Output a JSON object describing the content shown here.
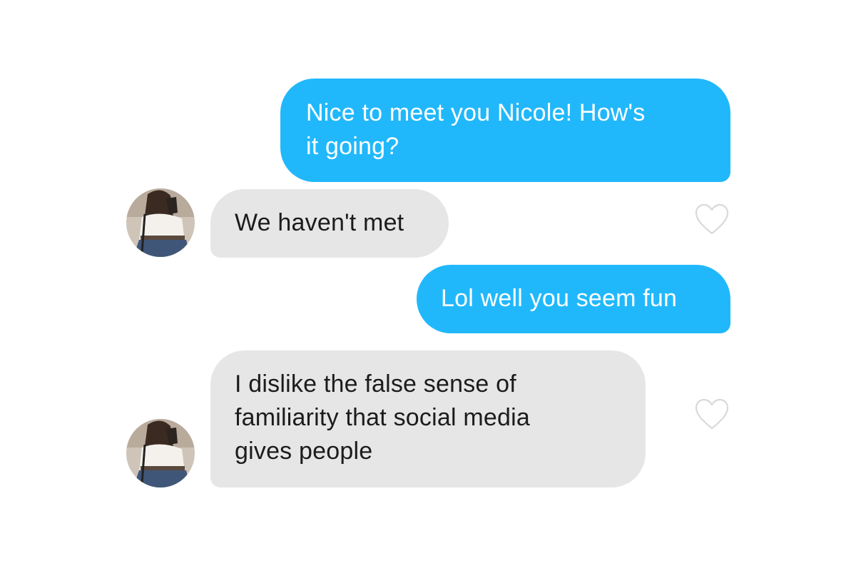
{
  "conversation": {
    "messages": [
      {
        "sender": "me",
        "text": "Nice to meet you Nicole! How's\nit going?"
      },
      {
        "sender": "match",
        "text": "We haven't met",
        "liked": false
      },
      {
        "sender": "me",
        "text": "Lol well you seem fun"
      },
      {
        "sender": "match",
        "text": "I dislike the false sense of\nfamiliarity that social media\ngives people",
        "liked": false
      }
    ]
  },
  "icons": {
    "like": "heart-outline-icon",
    "avatar": "profile-photo-avatar"
  },
  "colors": {
    "sent_bubble": "#21b8fb",
    "received_bubble": "#e6e6e6",
    "sent_text": "#ffffff",
    "received_text": "#1c1c1c",
    "heart_outline": "#d9d9d9",
    "background": "#ffffff"
  }
}
